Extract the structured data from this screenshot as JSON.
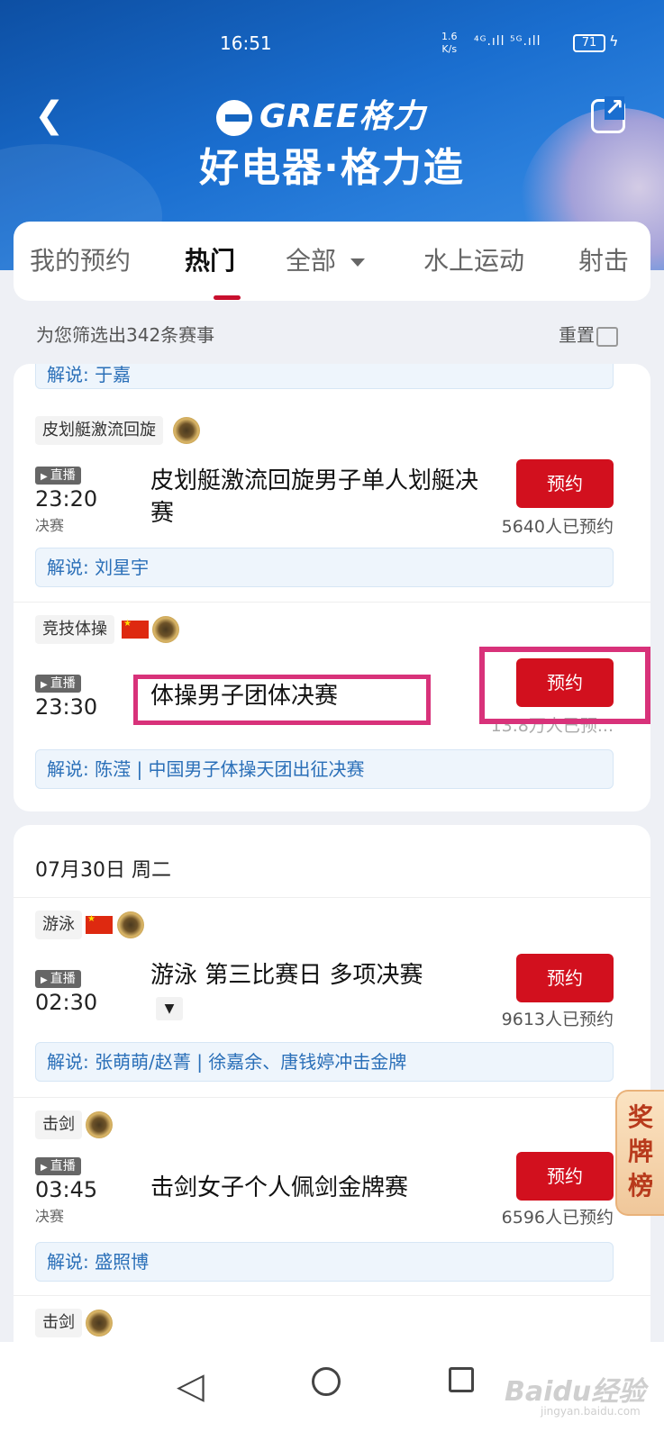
{
  "status": {
    "time": "16:51",
    "net_speed": "1.6",
    "net_unit": "K/s",
    "signal": "⁴ᴳ.ıll ⁵ᴳ.ıll",
    "battery": "71"
  },
  "header": {
    "brand": "GREE格力",
    "slogan": "好电器·格力造"
  },
  "tabs": [
    {
      "label": "我的预约"
    },
    {
      "label": "热门"
    },
    {
      "label": "全部"
    },
    {
      "label": "水上运动"
    },
    {
      "label": "射击"
    }
  ],
  "filter": {
    "summary": "为您筛选出342条赛事",
    "reset_label": "重置"
  },
  "card1": {
    "partial_commentary": "解说: 于嘉",
    "items": [
      {
        "sport": "皮划艇激流回旋",
        "live": "直播",
        "time": "23:20",
        "stage": "决赛",
        "title": "皮划艇激流回旋男子单人划艇决赛",
        "btn": "预约",
        "count": "5640人已预约",
        "commentary": "解说: 刘星宇"
      },
      {
        "sport": "竞技体操",
        "live": "直播",
        "time": "23:30",
        "title": "体操男子团体决赛",
        "btn": "预约",
        "count": "13.8万人已预...",
        "commentary": "解说: 陈滢 | 中国男子体操天团出征决赛"
      }
    ]
  },
  "card2": {
    "date": "07月30日 周二",
    "items": [
      {
        "sport": "游泳",
        "live": "直播",
        "time": "02:30",
        "title": "游泳 第三比赛日 多项决赛",
        "btn": "预约",
        "count": "9613人已预约",
        "commentary": "解说: 张萌萌/赵菁 | 徐嘉余、唐钱婷冲击金牌"
      },
      {
        "sport": "击剑",
        "live": "直播",
        "time": "03:45",
        "stage": "决赛",
        "title": "击剑女子个人佩剑金牌赛",
        "btn": "预约",
        "count": "6596人已预约",
        "commentary": "解说: 盛照博"
      },
      {
        "sport": "击剑"
      }
    ]
  },
  "medal_tab": {
    "line1": "奖",
    "line2": "牌",
    "line3": "榜"
  },
  "watermark": {
    "main": "Baidu经验",
    "sub": "jingyan.baidu.com"
  }
}
